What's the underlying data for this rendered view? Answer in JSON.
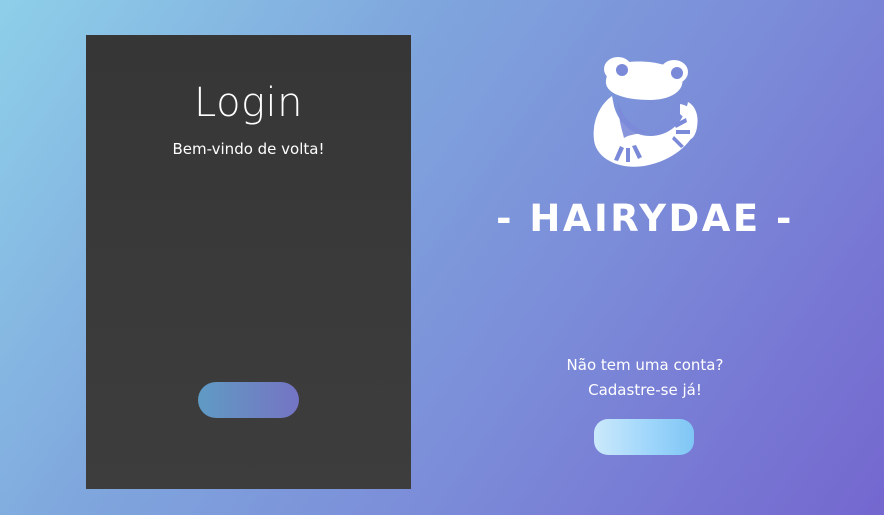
{
  "login": {
    "title": "Login",
    "subtitle": "Bem-vindo de volta!",
    "button_label": ""
  },
  "brand": {
    "logo_icon": "frog-icon",
    "name": "- HAIRYDAE -"
  },
  "signup": {
    "prompt_line1": "Não tem uma conta?",
    "prompt_line2": "Cadastre-se já!",
    "button_label": ""
  },
  "colors": {
    "background_start": "#8ecfe9",
    "background_end": "#7467cf",
    "card": "#393939",
    "login_button_start": "#5f9bc4",
    "login_button_end": "#7474c4",
    "signup_button_start": "#cbe9fb",
    "signup_button_end": "#7fc6f5"
  }
}
